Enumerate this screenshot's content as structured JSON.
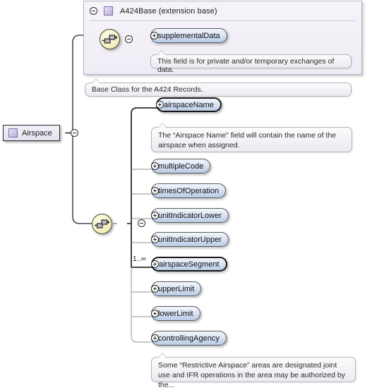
{
  "diagram": {
    "type": "xsd-schema-element-tree",
    "root": {
      "name": "Airspace",
      "icon": "complextype-square-icon",
      "toggle": "minus-circle-icon"
    },
    "extension_base": {
      "title": "A424Base (extension base)",
      "toggle": "minus-circle-icon",
      "icon": "complextype-square-icon",
      "compositor": "sequence-icon",
      "compositor_toggle": "minus-circle-icon",
      "children": [
        {
          "name": "supplementalData",
          "expander": "plus-circle-icon",
          "required": false,
          "occurrence": "",
          "annotation": "This field is for private and/or temporary exchanges of data."
        }
      ],
      "annotation": "Base Class for the A424 Records."
    },
    "main_sequence": {
      "compositor": "sequence-icon",
      "compositor_toggle": "minus-circle-icon",
      "children": [
        {
          "name": "airspaceName",
          "expander": "plus-circle-icon",
          "required": true,
          "occurrence": "",
          "annotation": "The “Airspace Name” field will contain the name of the airspace when assigned."
        },
        {
          "name": "multipleCode",
          "expander": "plus-circle-icon",
          "required": false,
          "occurrence": "",
          "annotation": ""
        },
        {
          "name": "timesOfOperation",
          "expander": "plus-circle-icon",
          "required": false,
          "occurrence": "",
          "annotation": ""
        },
        {
          "name": "unitIndicatorLower",
          "expander": "plus-circle-icon",
          "required": false,
          "occurrence": "",
          "annotation": ""
        },
        {
          "name": "unitIndicatorUpper",
          "expander": "plus-circle-icon",
          "required": false,
          "occurrence": "",
          "annotation": ""
        },
        {
          "name": "airspaceSegment",
          "expander": "plus-circle-icon",
          "required": true,
          "occurrence": "1..∞",
          "annotation": ""
        },
        {
          "name": "upperLimit",
          "expander": "plus-circle-icon",
          "required": false,
          "occurrence": "",
          "annotation": ""
        },
        {
          "name": "lowerLimit",
          "expander": "plus-circle-icon",
          "required": false,
          "occurrence": "",
          "annotation": ""
        },
        {
          "name": "controllingAgency",
          "expander": "plus-circle-icon",
          "required": false,
          "occurrence": "",
          "annotation": "Some “Restrictive Airspace” areas are designated joint use and IFR operations in the area may be authorized by the..."
        }
      ]
    },
    "colors": {
      "panel_bg": "#f3f0f8",
      "panel_border": "#b9b4c4",
      "pill_fill": "#c7d6ea",
      "pill_border": "#5b5b5b",
      "sequence_fill": "#f6f0c4",
      "sequence_border": "#4a4630",
      "complextype_purple": "#c3b8dd",
      "annotation_bg": "#f2f0f5",
      "connector": "#6e6e6e",
      "connector_bold": "#2b2b2b"
    }
  }
}
